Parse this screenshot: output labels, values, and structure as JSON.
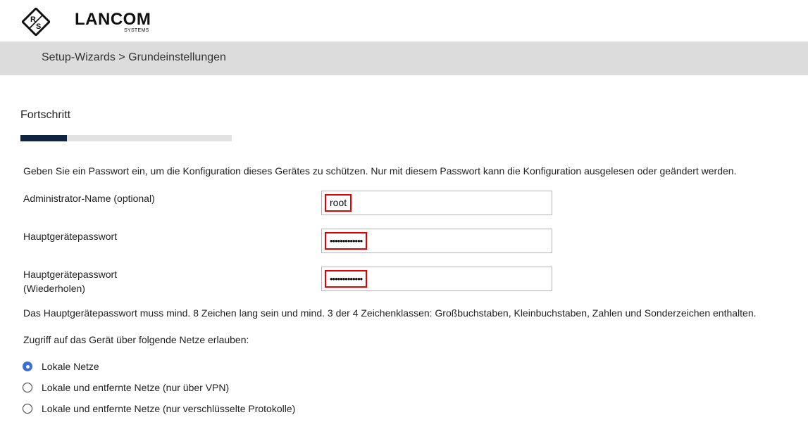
{
  "brand": {
    "name": "LANCOM",
    "sub": "SYSTEMS",
    "mark_letters": "R S"
  },
  "breadcrumb": "Setup-Wizards > Grundeinstellungen",
  "progress": {
    "label": "Fortschritt",
    "fraction": 0.22
  },
  "intro": "Geben Sie ein Passwort ein, um die Konfiguration dieses Gerätes zu schützen. Nur mit diesem Passwort kann die Konfiguration ausgelesen oder geändert werden.",
  "fields": [
    {
      "label": "Administrator-Name (optional)",
      "value": "root"
    },
    {
      "label": "Hauptgerätepasswort",
      "value": "•••••••••••••"
    },
    {
      "label": "Hauptgerätepasswort\n(Wiederholen)",
      "value": "•••••••••••••"
    }
  ],
  "password_rule": "Das Hauptgerätepasswort muss mind. 8 Zeichen lang sein und mind. 3 der 4 Zeichenklassen: Großbuchstaben, Kleinbuchstaben, Zahlen und Sonderzeichen enthalten.",
  "access": {
    "label": "Zugriff auf das Gerät über folgende Netze erlauben:",
    "options": [
      {
        "label": "Lokale Netze",
        "checked": true
      },
      {
        "label": "Lokale und entfernte Netze (nur über VPN)",
        "checked": false
      },
      {
        "label": "Lokale und entfernte Netze (nur verschlüsselte Protokolle)",
        "checked": false
      }
    ]
  },
  "colors": {
    "accent": "#0e2440",
    "radio": "#3b6fd8",
    "highlight": "#e00000"
  }
}
